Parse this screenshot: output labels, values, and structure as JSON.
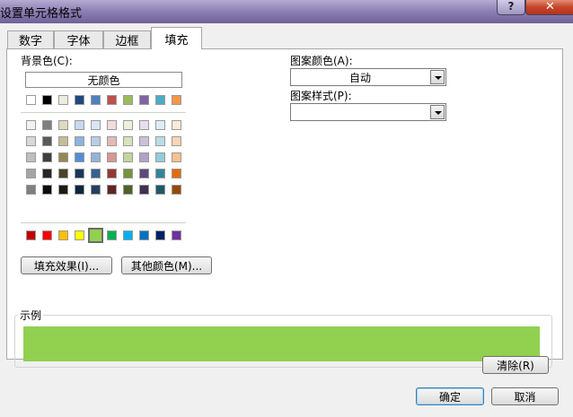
{
  "window": {
    "title": "设置单元格格式",
    "help_label": "?",
    "close_label": "✕"
  },
  "tabs": [
    {
      "label": "数字",
      "active": false
    },
    {
      "label": "字体",
      "active": false
    },
    {
      "label": "边框",
      "active": false
    },
    {
      "label": "填充",
      "active": true
    }
  ],
  "fill": {
    "background_label": "背景色(C):",
    "no_color_label": "无颜色",
    "theme_top_row": [
      "#ffffff",
      "#000000",
      "#eeece1",
      "#1f497d",
      "#4f81bd",
      "#c0504d",
      "#9bbb59",
      "#8064a2",
      "#4bacc6",
      "#f79646"
    ],
    "tint_rows": [
      [
        "#f2f2f2",
        "#7f7f7f",
        "#ddd9c3",
        "#c6d9f0",
        "#dbe5f1",
        "#f2dcdb",
        "#ebf1dd",
        "#e5e0ec",
        "#dbeef3",
        "#fdeada"
      ],
      [
        "#d8d8d8",
        "#595959",
        "#c4bd97",
        "#8db3e2",
        "#b8cce4",
        "#e5b9b7",
        "#d7e3bc",
        "#ccc1d9",
        "#b7dde8",
        "#fbd5b5"
      ],
      [
        "#bfbfbf",
        "#3f3f3f",
        "#938953",
        "#548dd4",
        "#95b3d7",
        "#d99694",
        "#c3d69b",
        "#b2a2c7",
        "#92cddc",
        "#fac08f"
      ],
      [
        "#a5a5a5",
        "#262626",
        "#494429",
        "#17365d",
        "#366092",
        "#953734",
        "#76923c",
        "#5f497a",
        "#31859b",
        "#e36c09"
      ],
      [
        "#7f7f7f",
        "#0c0c0c",
        "#1d1b10",
        "#0f243e",
        "#244061",
        "#632423",
        "#4f6128",
        "#3f3151",
        "#205867",
        "#974806"
      ]
    ],
    "standard_colors": [
      "#c00000",
      "#ff0000",
      "#ffc000",
      "#ffff00",
      "#92d050",
      "#00b050",
      "#00b0f0",
      "#0070c0",
      "#002060",
      "#7030a0"
    ],
    "selected_color": "#92d050",
    "fill_effects_label": "填充效果(I)...",
    "more_colors_label": "其他颜色(M)...",
    "pattern_color_label": "图案颜色(A):",
    "pattern_color_value": "自动",
    "pattern_style_label": "图案样式(P):",
    "pattern_style_value": "",
    "sample_label": "示例"
  },
  "buttons": {
    "clear_label": "清除(R)",
    "ok_label": "确定",
    "cancel_label": "取消"
  }
}
